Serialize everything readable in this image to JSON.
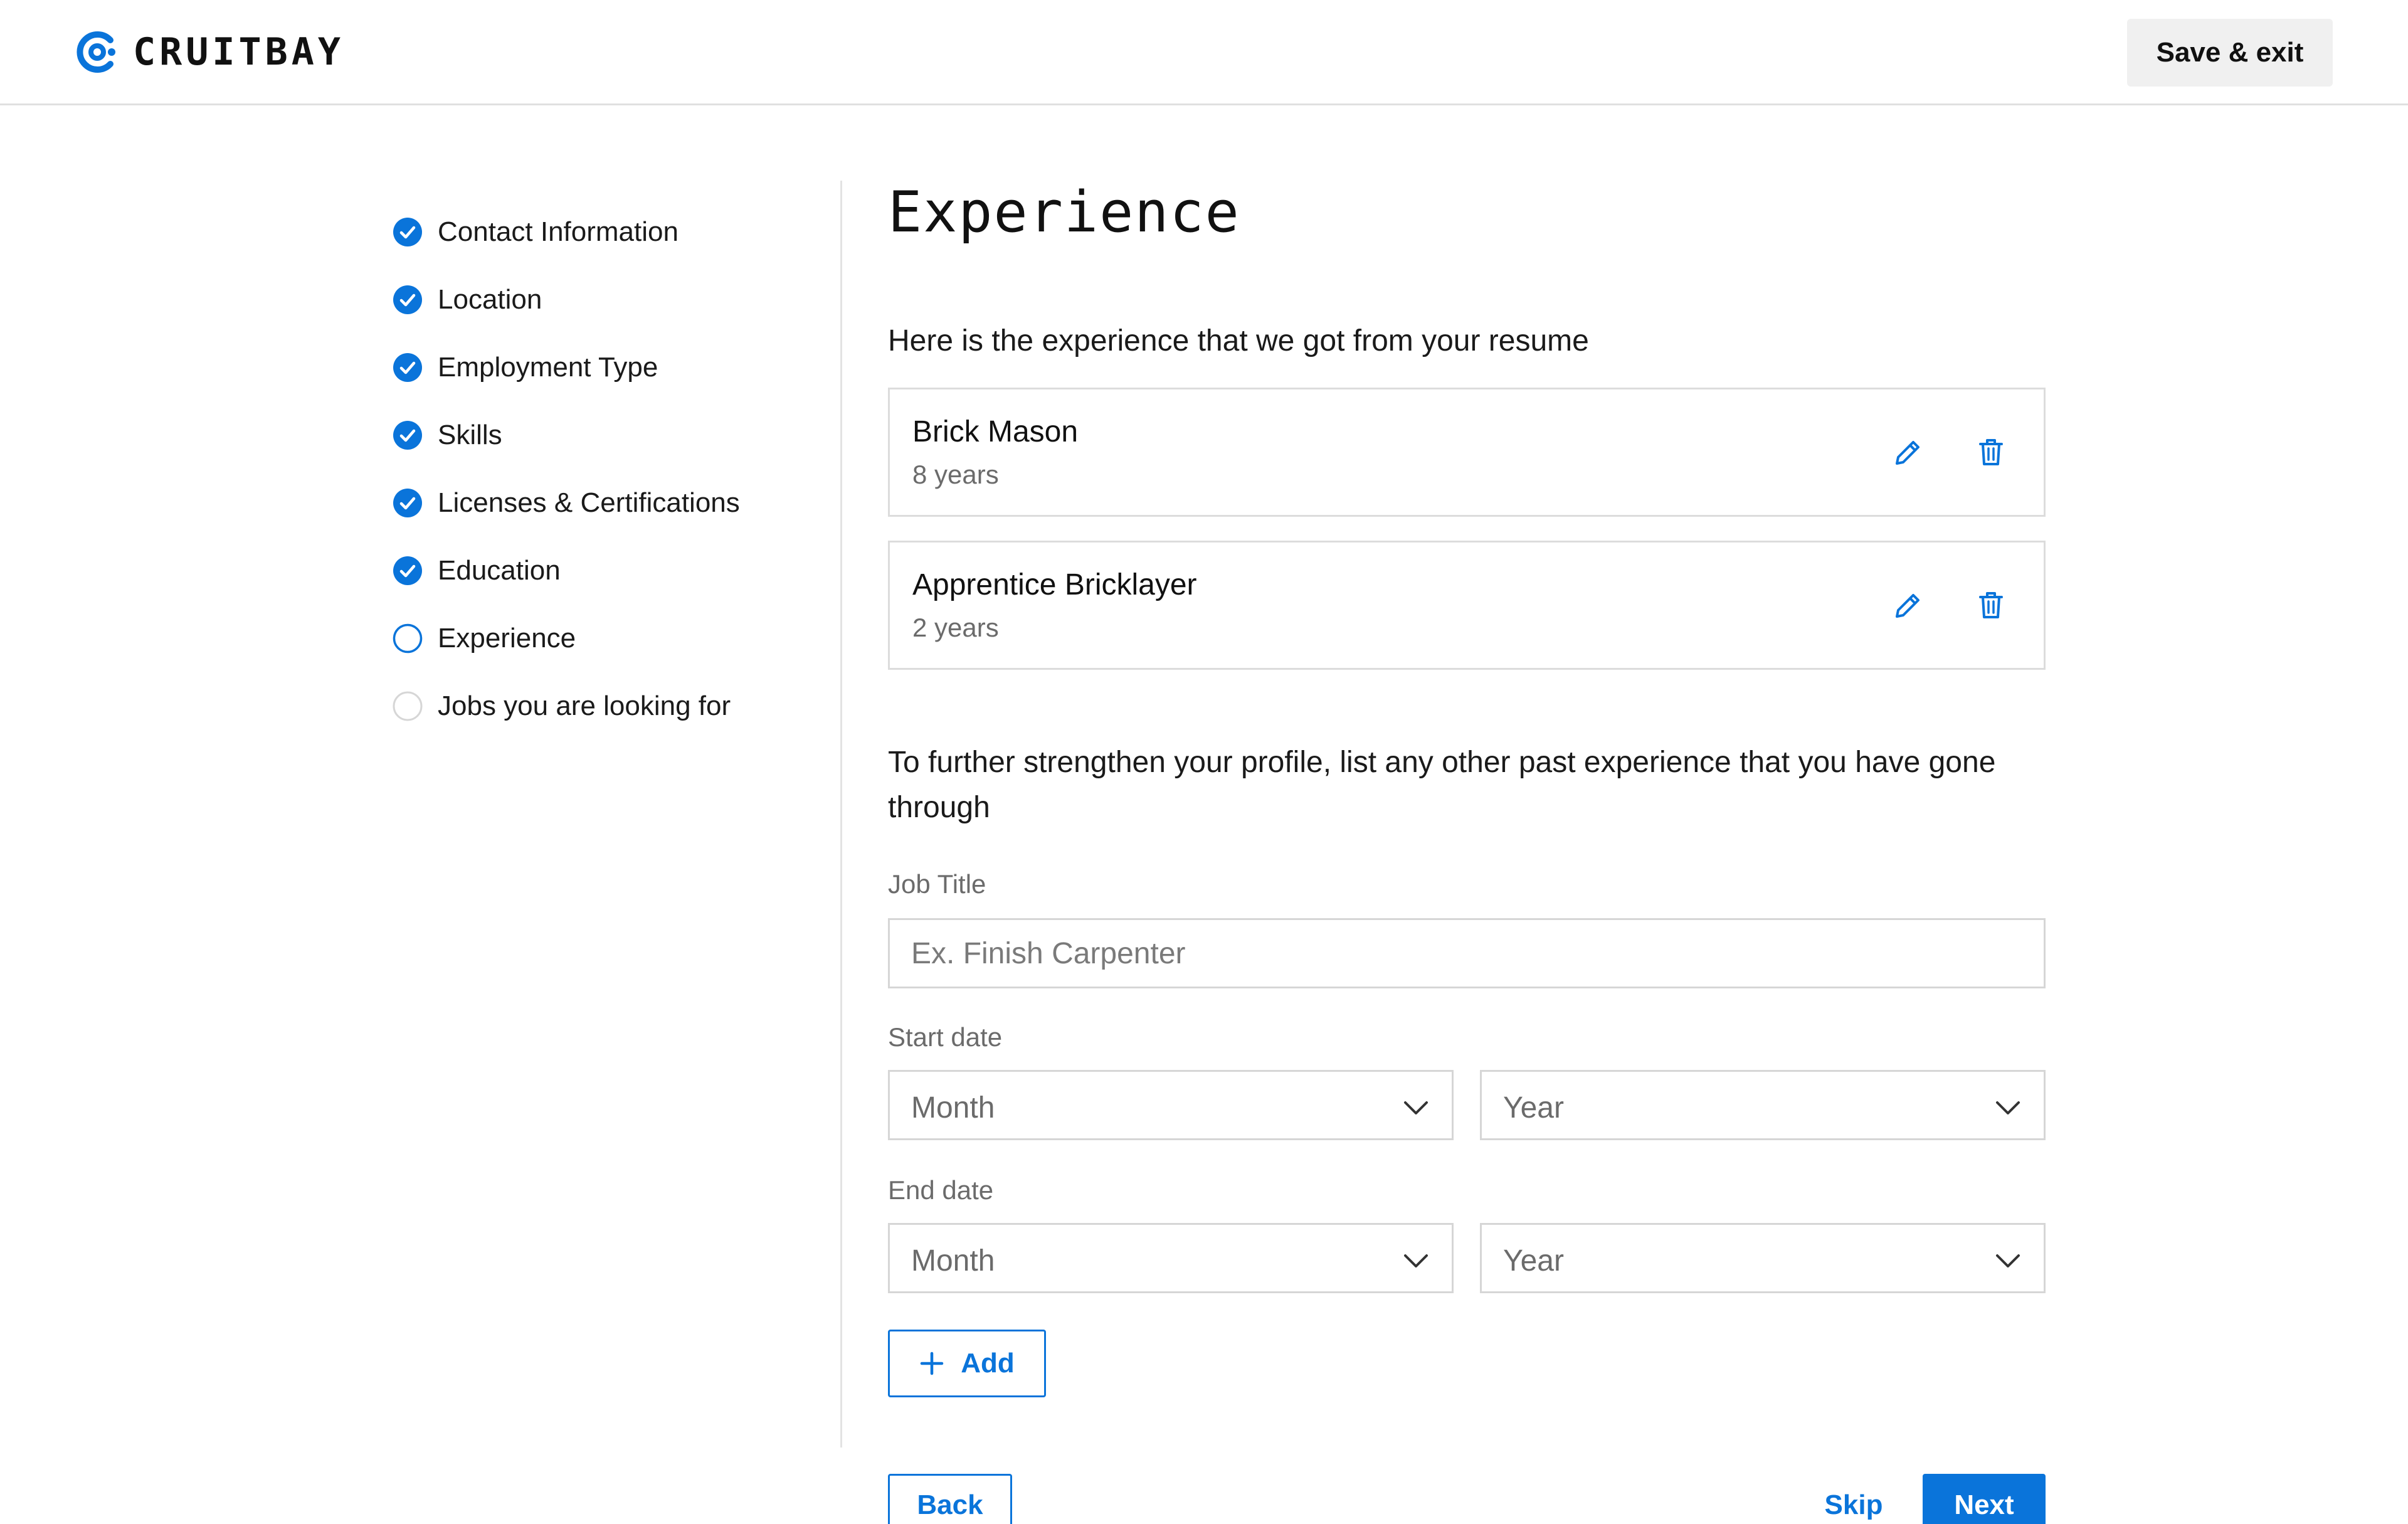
{
  "colors": {
    "accent": "#0a74da",
    "border": "#d6d6d6",
    "muted": "#6b6b6b"
  },
  "header": {
    "brand": "CRUITBAY",
    "logo_icon": "cruitbay-logo-icon",
    "save_exit_label": "Save & exit"
  },
  "steps": [
    {
      "label": "Contact Information",
      "status": "complete"
    },
    {
      "label": "Location",
      "status": "complete"
    },
    {
      "label": "Employment Type",
      "status": "complete"
    },
    {
      "label": "Skills",
      "status": "complete"
    },
    {
      "label": "Licenses & Certifications",
      "status": "complete"
    },
    {
      "label": "Education",
      "status": "complete"
    },
    {
      "label": "Experience",
      "status": "current"
    },
    {
      "label": "Jobs you are looking for",
      "status": "pending"
    }
  ],
  "main": {
    "title": "Experience",
    "intro": "Here is the experience that we got from your resume",
    "experiences": [
      {
        "title": "Brick Mason",
        "duration": "8 years"
      },
      {
        "title": "Apprentice Bricklayer",
        "duration": "2 years"
      }
    ],
    "further_text": "To further strengthen your profile, list any other past experience that you have gone through",
    "job_title": {
      "label": "Job Title",
      "value": "",
      "placeholder": "Ex. Finish Carpenter"
    },
    "start_date": {
      "label": "Start date",
      "month": "Month",
      "year": "Year"
    },
    "end_date": {
      "label": "End date",
      "month": "Month",
      "year": "Year"
    },
    "add_label": "Add",
    "back_label": "Back",
    "skip_label": "Skip",
    "next_label": "Next"
  }
}
